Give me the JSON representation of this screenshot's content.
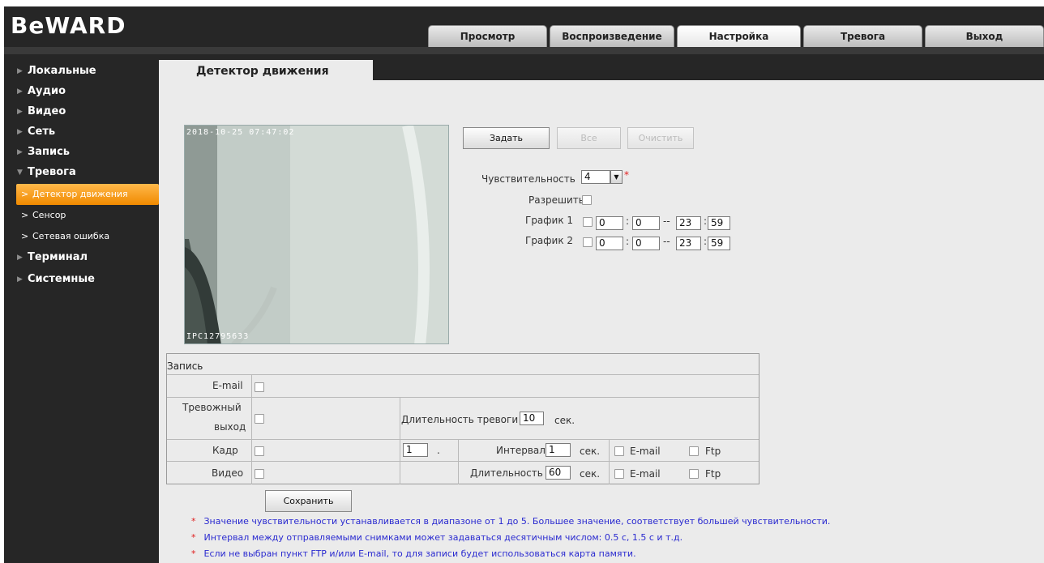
{
  "brand": "BeWARD",
  "tabs": [
    "Просмотр",
    "Воспроизведение",
    "Настройка",
    "Тревога",
    "Выход"
  ],
  "sidebar": {
    "items": [
      "Локальные",
      "Аудио",
      "Видео",
      "Сеть",
      "Запись",
      "Тревога"
    ],
    "subitems": [
      "Детектор движения",
      "Сенсор",
      "Сетевая ошибка"
    ],
    "items2": [
      "Терминал",
      "Системные"
    ]
  },
  "content_tab": "Детектор движения",
  "video": {
    "timestamp": "2018-10-25 07:47:02",
    "label": "IPC12795633"
  },
  "buttons": {
    "set": "Задать",
    "all": "Все",
    "clear": "Очистить",
    "save": "Сохранить"
  },
  "settings": {
    "sensitivity_label": "Чувствительность",
    "sensitivity_value": "4",
    "enable_label": "Разрешить",
    "schedule1_label": "График 1",
    "schedule2_label": "График 2",
    "schedule1": [
      "0",
      "0",
      "23",
      "59"
    ],
    "schedule2": [
      "0",
      "0",
      "23",
      "59"
    ],
    "colon": ":",
    "dash": "--"
  },
  "record": {
    "title": "Запись",
    "email_label": "E-mail",
    "alarm_out_label_1": "Тревожный",
    "alarm_out_label_2": "выход",
    "alarm_duration_label": "Длительность тревоги",
    "alarm_duration_value": "10",
    "sec": "сек.",
    "frame_label": "Кадр",
    "frame_value": "1",
    "dot": ".",
    "interval_label": "Интервал",
    "interval_value": "1",
    "video_label": "Видео",
    "video_duration_label": "Длительность",
    "video_duration_value": "60",
    "email": "E-mail",
    "ftp": "Ftp"
  },
  "notes": [
    "Значение чувствительности устанавливается в диапазоне от 1 до 5. Большее значение, соответствует большей чувствительности.",
    "Интервал между отправляемыми снимками может задаваться десятичным числом: 0.5 с, 1.5 с и т.д.",
    "Если не выбран пункт FTP и/или E-mail, то для записи будет использоваться карта памяти."
  ],
  "colors": {
    "accent": "#f08a00",
    "dark": "#262626",
    "panel": "#ebebeb",
    "note": "#2a2ad0"
  }
}
